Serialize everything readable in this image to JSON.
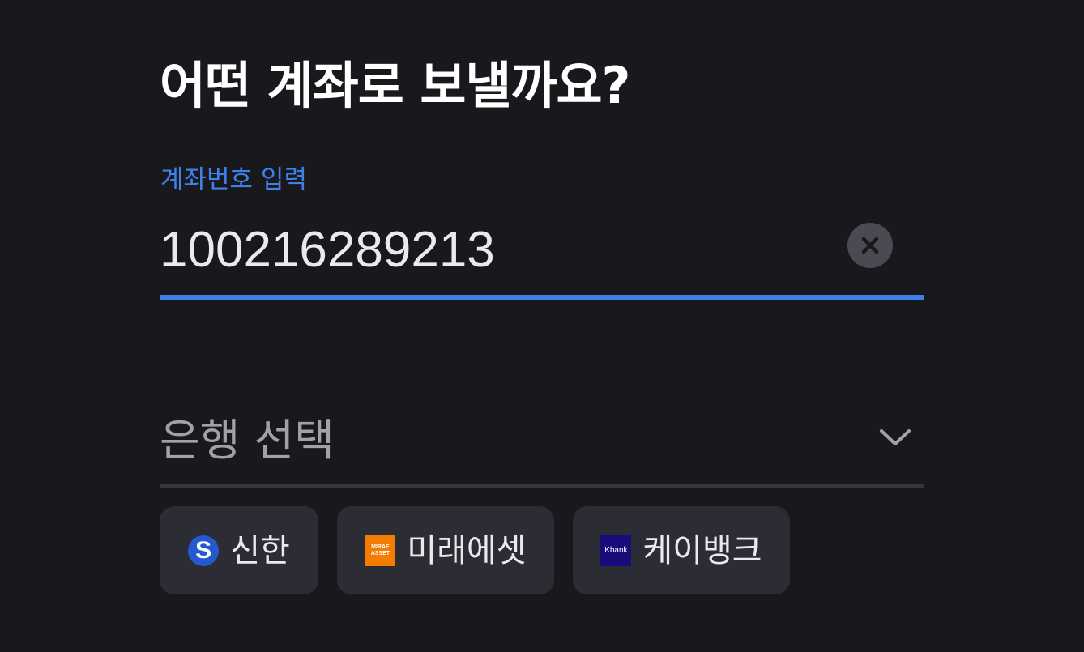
{
  "page": {
    "title": "어떤 계좌로 보낼까요?"
  },
  "account_input": {
    "label": "계좌번호 입력",
    "value": "100216289213",
    "clear_icon": "close-circle-icon",
    "accent_color": "#3e82e9"
  },
  "bank_select": {
    "placeholder": "은행 선택",
    "chevron_icon": "chevron-down-icon"
  },
  "bank_chips": [
    {
      "label": "신한",
      "logo": "shinhan-logo-icon",
      "logo_text": "S",
      "logo_color": "#2459cf"
    },
    {
      "label": "미래에셋",
      "logo": "mirae-asset-logo-icon",
      "logo_text": "MIRAE ASSET",
      "logo_color": "#f47c00"
    },
    {
      "label": "케이뱅크",
      "logo": "kbank-logo-icon",
      "logo_text": "Kbank",
      "logo_color": "#170c7a"
    }
  ],
  "colors": {
    "background": "#18181d",
    "chip_background": "#2c2c34",
    "text_primary": "#ffffff",
    "text_placeholder": "#a1a1a9"
  }
}
